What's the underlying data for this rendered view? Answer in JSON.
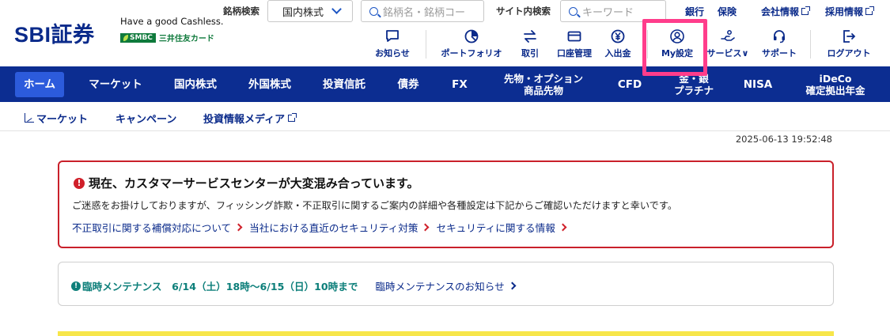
{
  "header": {
    "logo": "SBI証券",
    "cashless": "Have a good Cashless.",
    "smbc_badge": "SMBC",
    "smbc_text": "三井住友カード",
    "stock_search_label": "銘柄検索",
    "stock_search_select": "国内株式",
    "stock_search_placeholder": "銘柄名・銘柄コー",
    "site_search_label": "サイト内検索",
    "site_search_placeholder": "キーワード",
    "top_links": [
      "銀行",
      "保険",
      "会社情報",
      "採用情報"
    ],
    "icons": [
      {
        "label": "お知らせ",
        "icon": "chat-icon"
      },
      {
        "label": "ポートフォリオ",
        "icon": "pie-chart-icon"
      },
      {
        "label": "取引",
        "icon": "exchange-icon"
      },
      {
        "label": "口座管理",
        "icon": "card-icon"
      },
      {
        "label": "入出金",
        "icon": "yen-icon"
      },
      {
        "label": "My設定",
        "icon": "user-settings-icon"
      },
      {
        "label": "サービス",
        "icon": "hand-icon"
      },
      {
        "label": "サポート",
        "icon": "headset-icon"
      },
      {
        "label": "ログアウト",
        "icon": "logout-icon"
      }
    ]
  },
  "nav": {
    "items": [
      {
        "label": "ホーム"
      },
      {
        "label": "マーケット"
      },
      {
        "label": "国内株式"
      },
      {
        "label": "外国株式"
      },
      {
        "label": "投資信託"
      },
      {
        "label": "債券"
      },
      {
        "label": "FX"
      },
      {
        "label": "先物・オプション",
        "label2": "商品先物"
      },
      {
        "label": "CFD"
      },
      {
        "label": "金・銀",
        "label2": "プラチナ"
      },
      {
        "label": "NISA"
      },
      {
        "label": "iDeCo",
        "label2": "確定拠出年金"
      }
    ]
  },
  "subnav": {
    "items": [
      "マーケット",
      "キャンペーン",
      "投資情報メディア"
    ]
  },
  "timestamp": "2025-06-13 19:52:48",
  "alert": {
    "title": "現在、カスタマーサービスセンターが大変混み合っています。",
    "body": "ご迷惑をお掛けしておりますが、フィッシング詐欺・不正取引に関するご案内の詳細や各種設定は下記からご確認いただけますと幸いです。",
    "links": [
      "不正取引に関する補償対応について",
      "当社における直近のセキュリティ対策",
      "セキュリティに関する情報"
    ]
  },
  "maintenance": {
    "text": "臨時メンテナンス　6/14（土）18時～6/15（日）10時まで",
    "link": "臨時メンテナンスのお知らせ"
  },
  "colors": {
    "brand_navy": "#0c2d91",
    "active_tab": "#2c5bdc",
    "alert_red": "#c9202a",
    "highlight": "#ff3d8b",
    "maintenance_teal": "#0d7f7a"
  }
}
